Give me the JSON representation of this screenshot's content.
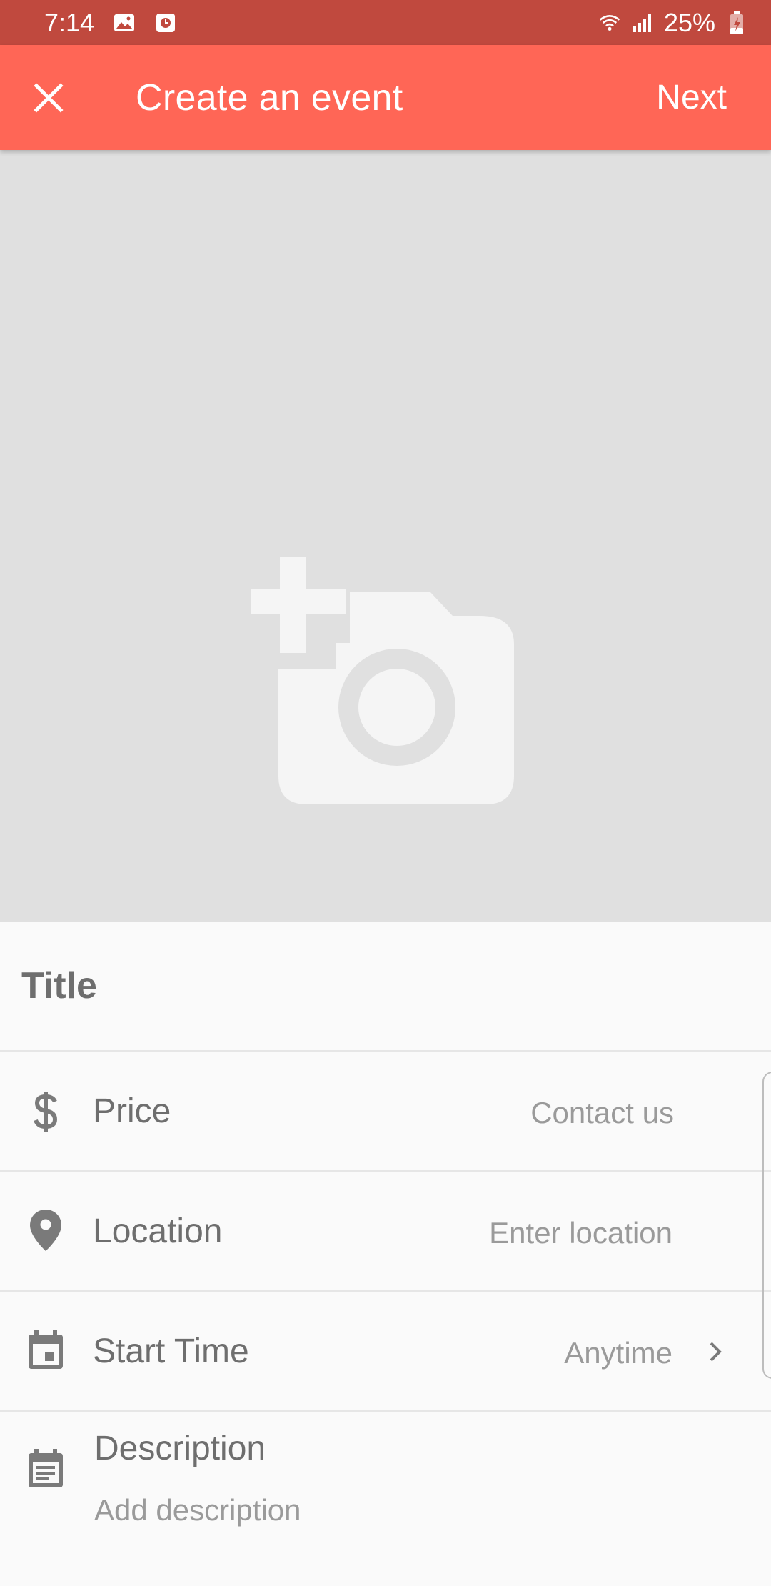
{
  "status_bar": {
    "time": "7:14",
    "battery": "25%",
    "icons": [
      "gallery-icon",
      "clock-app-icon",
      "wifi-icon",
      "signal-icon",
      "battery-charging-icon"
    ]
  },
  "app_bar": {
    "title": "Create an event",
    "close_icon": "close-icon",
    "next_label": "Next"
  },
  "image_picker": {
    "icon": "add-photo-icon"
  },
  "form": {
    "title_placeholder": "Title",
    "rows": [
      {
        "icon": "dollar-icon",
        "label": "Price",
        "value": "Contact us"
      },
      {
        "icon": "location-pin-icon",
        "label": "Location",
        "value": "Enter location"
      },
      {
        "icon": "calendar-icon",
        "label": "Start Time",
        "value": "Anytime"
      }
    ],
    "description": {
      "icon": "description-icon",
      "label": "Description",
      "placeholder": "Add description"
    }
  },
  "colors": {
    "status_bar": "#c0493e",
    "app_bar": "#ff6656",
    "image_bg": "#e0e0e0",
    "text_dark": "#6e6e6e",
    "text_light": "#9a9a9a"
  }
}
